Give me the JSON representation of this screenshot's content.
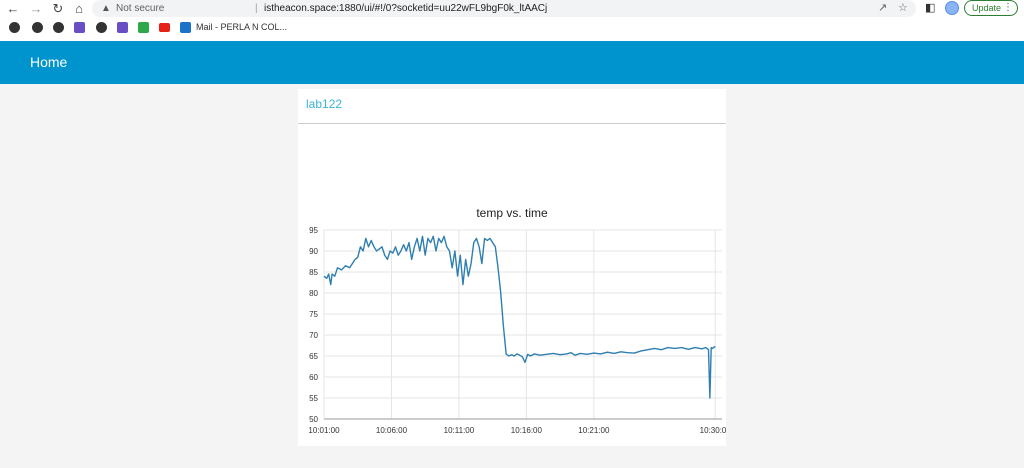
{
  "browser": {
    "not_secure": "Not secure",
    "separator": "|",
    "url": "istheacon.space:1880/ui/#!/0?socketid=uu22wFL9bgF0k_ltAACj",
    "update_label": "Update",
    "bookmark_mail_label": "Mail - PERLA N COL..."
  },
  "dashboard": {
    "header_title": "Home",
    "group_title": "lab122",
    "header_color": "#0094ce",
    "group_title_color": "#3bb3d8"
  },
  "chart_data": {
    "type": "line",
    "title": "temp vs. time",
    "xlabel": "",
    "ylabel": "",
    "ylim": [
      50,
      95
    ],
    "yticks": [
      95,
      90,
      85,
      80,
      75,
      70,
      65,
      60,
      55,
      50
    ],
    "xticks": [
      "10:01:00",
      "10:06:00",
      "10:11:00",
      "10:16:00",
      "10:21:00",
      "10:30:00"
    ],
    "xtick_minutes": [
      0,
      5,
      10,
      15,
      20,
      29
    ],
    "line_color": "#2e7fb0",
    "grid": true,
    "series": [
      {
        "x": [
          0,
          0.2,
          0.35,
          0.5,
          0.6,
          0.8,
          1.0,
          1.3,
          1.6,
          1.9,
          2.1,
          2.3,
          2.5,
          2.7,
          2.9,
          3.1,
          3.3,
          3.5,
          3.7,
          3.9,
          4.1,
          4.3,
          4.5,
          4.7,
          4.9,
          5.1,
          5.3,
          5.5,
          5.7,
          5.9,
          6.1,
          6.3,
          6.5,
          6.7,
          6.9,
          7.1,
          7.3,
          7.5,
          7.7,
          7.9,
          8.1,
          8.3,
          8.5,
          8.7,
          8.9,
          9.1,
          9.3,
          9.5,
          9.7,
          9.9,
          10.1,
          10.3,
          10.5,
          10.7,
          10.9,
          11.1,
          11.3,
          11.5,
          11.7,
          11.9,
          12.1,
          12.3,
          12.5,
          12.7,
          12.9,
          13.1,
          13.3,
          13.5,
          13.7,
          13.9,
          14.1,
          14.3,
          14.5,
          14.7,
          14.9,
          15.1,
          15.3,
          15.6,
          16.0,
          16.5,
          17.0,
          17.5,
          18.0,
          18.3,
          18.6,
          19.0,
          19.5,
          20.0,
          20.5,
          21.0,
          21.5,
          22.0,
          22.5,
          23.0,
          23.5,
          24.0,
          24.5,
          25.0,
          25.5,
          26.0,
          26.5,
          27.0,
          27.5,
          28.0,
          28.3,
          28.5,
          28.6,
          28.7,
          28.8,
          29.0
        ],
        "y": [
          84,
          83.5,
          84.5,
          82,
          84.5,
          84,
          86,
          85.5,
          86.5,
          86,
          87,
          88,
          88.5,
          91,
          90,
          93,
          91,
          92.5,
          91,
          90,
          90.5,
          91,
          89,
          88,
          90,
          89.5,
          91,
          89,
          90,
          91.5,
          90,
          92,
          88,
          91,
          93,
          90,
          93.5,
          89,
          93,
          92,
          93.5,
          90,
          93,
          92,
          93.5,
          91,
          90,
          86,
          90,
          84,
          89,
          82,
          88,
          84,
          87,
          92,
          93,
          91,
          87,
          93,
          92.5,
          93,
          92,
          91,
          86,
          80,
          72,
          65.5,
          65,
          65.3,
          65,
          65.5,
          65.2,
          64.8,
          63.5,
          65.4,
          65,
          65.5,
          65.2,
          65.4,
          65.6,
          65.3,
          65.5,
          65.8,
          65.2,
          65.6,
          65.4,
          65.7,
          65.5,
          65.9,
          65.6,
          66,
          65.8,
          65.7,
          66.2,
          66.5,
          66.8,
          66.5,
          67,
          66.8,
          67,
          66.6,
          67,
          66.7,
          67,
          66.5,
          55,
          67,
          66.8,
          67.3
        ]
      }
    ]
  }
}
